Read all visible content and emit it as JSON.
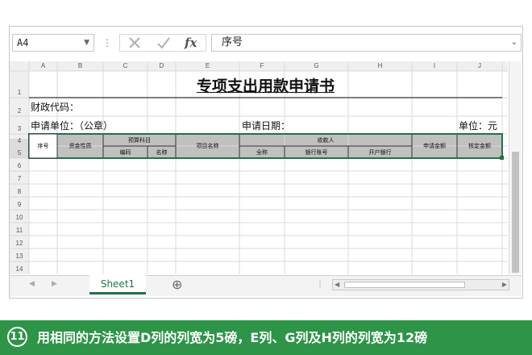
{
  "formula_bar": {
    "name_box": "A4",
    "sep": "⋮",
    "formula_value": "序号",
    "icons": [
      "cancel-icon",
      "enter-icon",
      "function-icon"
    ]
  },
  "columns": [
    "A",
    "B",
    "C",
    "D",
    "E",
    "F",
    "G",
    "H",
    "I",
    "J"
  ],
  "rows": [
    "1",
    "2",
    "3",
    "4",
    "5",
    "6",
    "7",
    "8",
    "9",
    "10",
    "11",
    "12",
    "13",
    "14"
  ],
  "sheet": {
    "title": "专项支出用款申请书",
    "finance_code_label": "财政代码：",
    "apply_unit_label": "申请单位：（公章）",
    "apply_date_label": "申请日期：",
    "unit_label": "单位：元",
    "table_headers": {
      "seq": "序号",
      "fund_nature": "资金性质",
      "budget_subject": "预算科目",
      "code": "编码",
      "name": "名称",
      "project_name": "项目名称",
      "payee": "收款人",
      "full_name": "全称",
      "bank_account": "银行账号",
      "bank": "开户银行",
      "apply_amount": "申请金额",
      "approved_amount": "核定金额"
    }
  },
  "tabs": {
    "sheet1": "Sheet1",
    "add": "⊕"
  },
  "caption": {
    "number": "11",
    "text": "用相同的方法设置D列的列宽为5磅，E列、G列及H列的列宽为12磅"
  },
  "colors": {
    "excel_green": "#217346",
    "caption_green": "#2d9448",
    "header_fill": "#c0c0c0"
  }
}
